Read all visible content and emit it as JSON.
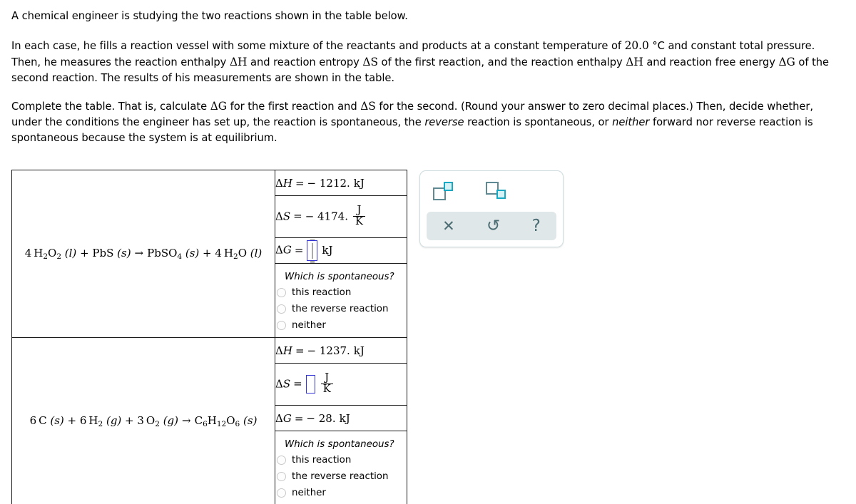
{
  "prose": {
    "p1": "A chemical engineer is studying the two reactions shown in the table below.",
    "p2_a": "In each case, he fills a reaction vessel with some mixture of the reactants and products at a constant temperature of ",
    "p2_temp": "20.0",
    "p2_b": " °C and constant total pressure. Then, he measures the reaction enthalpy ",
    "p2_dH": "ΔH",
    "p2_c": " and reaction entropy ",
    "p2_dS": "ΔS",
    "p2_d": " of the first reaction, and the reaction enthalpy ",
    "p2_dH2": "ΔH",
    "p2_e": " and reaction free energy ",
    "p2_dG": "ΔG",
    "p2_f": " of the second reaction. The results of his measurements are shown in the table.",
    "p3_a": "Complete the table. That is, calculate ",
    "p3_dG": "ΔG",
    "p3_b": " for the first reaction and ",
    "p3_dS": "ΔS",
    "p3_c": " for the second. (Round your answer to zero decimal places.) Then, decide whether, under the conditions the engineer has set up, the reaction is spontaneous, the ",
    "p3_rev": "reverse",
    "p3_d": " reaction is spontaneous, or ",
    "p3_nei": "neither",
    "p3_e": " forward nor reverse reaction is spontaneous because the system is at equilibrium."
  },
  "table": {
    "rows": [
      {
        "equation_text": "4 H2O2 (l) + PbS (s) → PbSO4 (s) + 4 H2O (l)",
        "enthalpy": {
          "symbol": "ΔH",
          "equals": "=",
          "value": "− 1212.",
          "unit": "kJ"
        },
        "entropy": {
          "symbol": "ΔS",
          "equals": "=",
          "value": "− 4174.",
          "unit_numerator": "J",
          "unit_denominator": "K",
          "is_input": false
        },
        "free_energy": {
          "symbol": "ΔG",
          "equals": "=",
          "value": "",
          "unit": "kJ",
          "is_input": true,
          "focused": true
        },
        "question": "Which is spontaneous?",
        "options": [
          "this reaction",
          "the reverse reaction",
          "neither"
        ],
        "selected": null
      },
      {
        "equation_text": "6 C (s) + 6 H2 (g) + 3 O2 (g) → C6H12O6 (s)",
        "enthalpy": {
          "symbol": "ΔH",
          "equals": "=",
          "value": "− 1237.",
          "unit": "kJ"
        },
        "entropy": {
          "symbol": "ΔS",
          "equals": "=",
          "value": "",
          "unit_numerator": "J",
          "unit_denominator": "K",
          "is_input": true,
          "focused": false
        },
        "free_energy": {
          "symbol": "ΔG",
          "equals": "=",
          "value": "− 28.",
          "unit": "kJ",
          "is_input": false
        },
        "question": "Which is spontaneous?",
        "options": [
          "this reaction",
          "the reverse reaction",
          "neither"
        ],
        "selected": null
      }
    ]
  },
  "toolbar": {
    "superscript_label": "superscript",
    "subscript_label": "subscript",
    "clear": "✕",
    "undo": "↺",
    "help": "?",
    "accent_color": "#17a9c4",
    "icon_color": "#4a6b72",
    "bar_color": "#dfe7e8"
  }
}
